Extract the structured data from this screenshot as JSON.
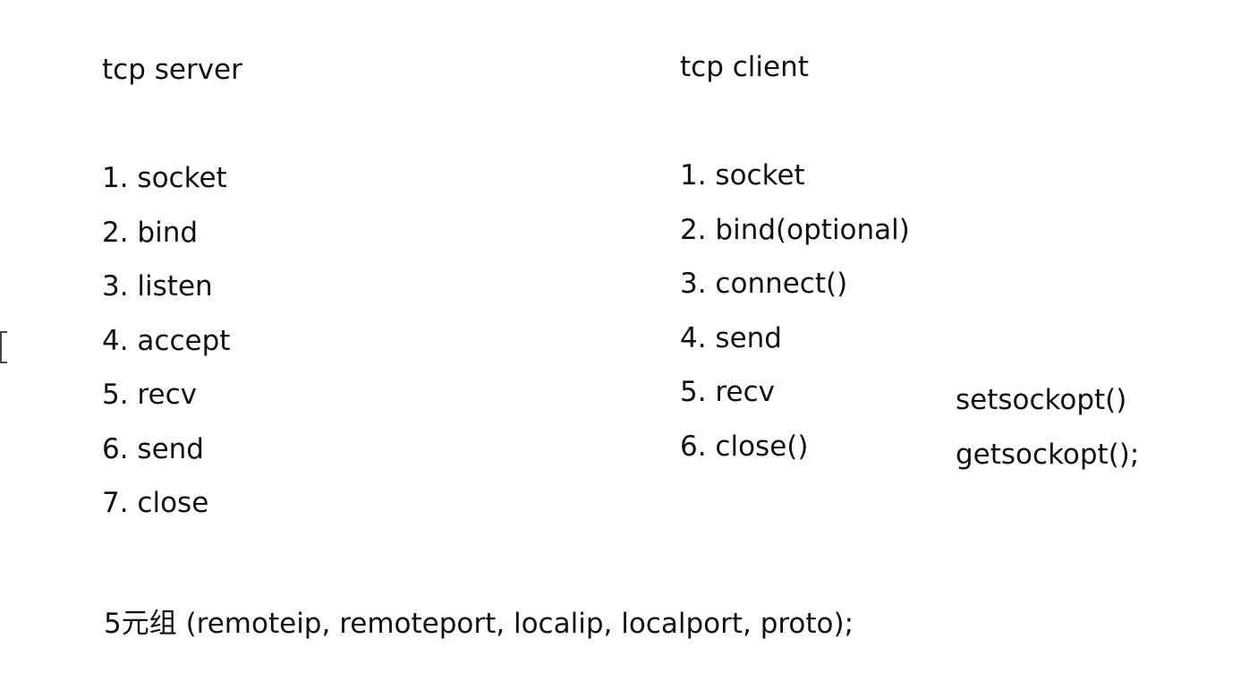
{
  "server": {
    "title": "tcp server",
    "steps": [
      "1. socket",
      "2. bind",
      "3. listen",
      "4. accept",
      "5. recv",
      "6. send",
      "7. close"
    ]
  },
  "client": {
    "title": "tcp client",
    "steps": [
      "1. socket",
      "2. bind(optional)",
      "3. connect()",
      "4. send",
      "5. recv",
      "6. close()"
    ]
  },
  "options": [
    "setsockopt()",
    "getsockopt();"
  ],
  "tuple_note": "5元组 (remoteip, remoteport, localip, localport, proto);"
}
